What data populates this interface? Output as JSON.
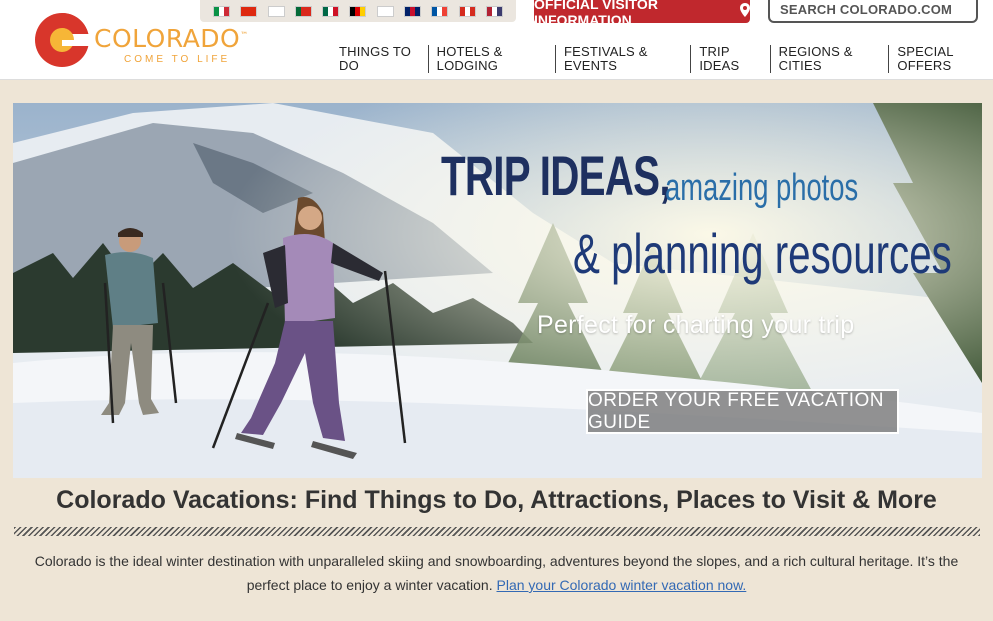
{
  "logo": {
    "word": "COLORADO",
    "tm": "™",
    "tagline": "COME TO LIFE"
  },
  "language_flags": [
    {
      "name": "italy-flag-icon",
      "colors": [
        "#0a9246",
        "#ffffff",
        "#ce2b37"
      ]
    },
    {
      "name": "china-flag-icon",
      "colors": [
        "#de2910"
      ]
    },
    {
      "name": "korea-flag-icon",
      "colors": [
        "#ffffff"
      ]
    },
    {
      "name": "portugal-flag-icon",
      "colors": [
        "#046a38",
        "#da291c",
        "#da291c"
      ]
    },
    {
      "name": "mexico-flag-icon",
      "colors": [
        "#006847",
        "#ffffff",
        "#ce1126"
      ]
    },
    {
      "name": "germany-flag-icon",
      "colors": [
        "#000000",
        "#dd0000",
        "#ffce00"
      ]
    },
    {
      "name": "japan-flag-icon",
      "colors": [
        "#ffffff"
      ]
    },
    {
      "name": "uk-flag-icon",
      "colors": [
        "#012169",
        "#c8102e",
        "#012169"
      ]
    },
    {
      "name": "france-flag-icon",
      "colors": [
        "#0055a4",
        "#ffffff",
        "#ef4135"
      ]
    },
    {
      "name": "canada-flag-icon",
      "colors": [
        "#d52b1e",
        "#ffffff",
        "#d52b1e"
      ]
    },
    {
      "name": "usa-flag-icon",
      "colors": [
        "#b22234",
        "#ffffff",
        "#3c3b6e"
      ]
    }
  ],
  "visitor_button": {
    "label": "OFFICIAL VISITOR INFORMATION",
    "icon": "map-pin-icon"
  },
  "search": {
    "placeholder": "SEARCH COLORADO.COM"
  },
  "nav": [
    "THINGS TO DO",
    "HOTELS & LODGING",
    "FESTIVALS & EVENTS",
    "TRIP IDEAS",
    "REGIONS & CITIES",
    "SPECIAL OFFERS"
  ],
  "hero": {
    "headline_1": "TRIP IDEAS,",
    "headline_1b": "amazing photos",
    "headline_2": "& planning resources",
    "subline": "Perfect for charting your trip",
    "cta": "ORDER YOUR FREE VACATION GUIDE"
  },
  "page_title": "Colorado Vacations: Find Things to Do, Attractions, Places to Visit & More",
  "intro": {
    "text": "Colorado is the ideal winter destination with unparalleled skiing and snowboarding, adventures beyond the slopes, and a rich cultural heritage. It’s the perfect place to enjoy a winter vacation. ",
    "link": "Plan your Colorado winter vacation now."
  },
  "colors": {
    "brand_red": "#c0282d",
    "brand_gold": "#f0a43a",
    "background": "#eee5d6",
    "link": "#3369b4"
  }
}
